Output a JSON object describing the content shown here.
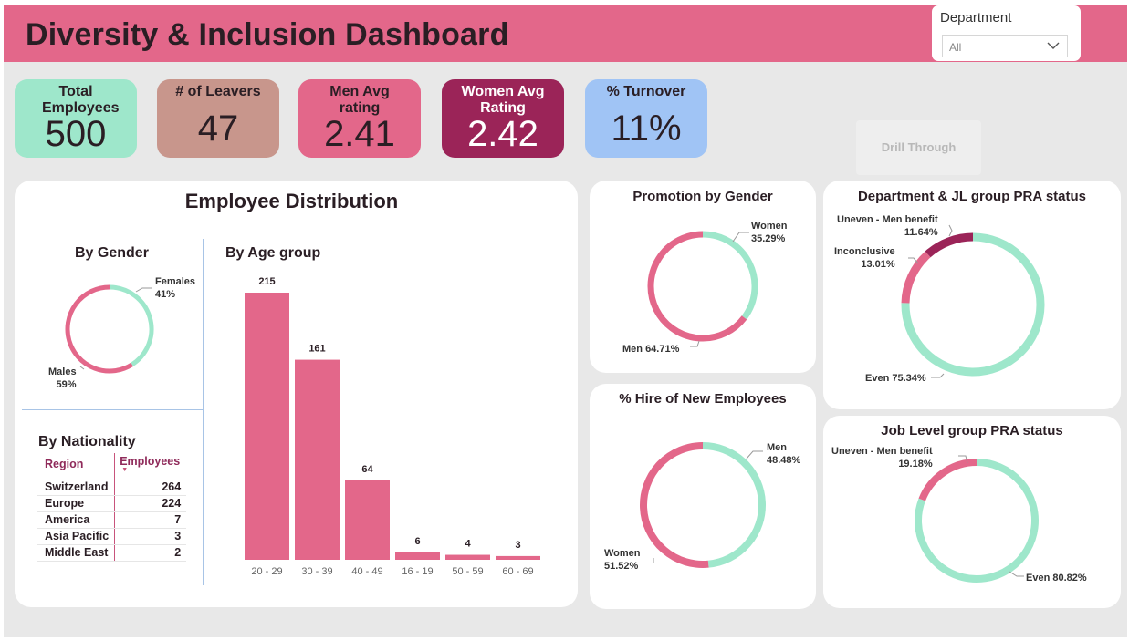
{
  "header": {
    "title": "Diversity & Inclusion Dashboard"
  },
  "slicer": {
    "label": "Department",
    "value": "All",
    "icon": "chevron-down-icon"
  },
  "kpis": [
    {
      "label": "Total Employees",
      "value": "500",
      "color": "#9ee7cb"
    },
    {
      "label": "# of Leavers",
      "value": "47",
      "color": "#c8968c"
    },
    {
      "label": "Men Avg rating",
      "value": "2.41",
      "color": "#e3678a"
    },
    {
      "label": "Women Avg Rating",
      "value": "2.42",
      "color": "#9b2458"
    },
    {
      "label": "% Turnover",
      "value": "11%",
      "color": "#a0c4f5"
    }
  ],
  "drill_through": {
    "label": "Drill Through"
  },
  "employee_distribution": {
    "title": "Employee Distribution",
    "by_gender_title": "By Gender",
    "by_age_title": "By Age group",
    "by_nationality_title": "By Nationality",
    "nationality_table": {
      "columns": [
        "Region",
        "Employees"
      ],
      "rows": [
        [
          "Switzerland",
          "264"
        ],
        [
          "Europe",
          "224"
        ],
        [
          "America",
          "7"
        ],
        [
          "Asia Pacific",
          "3"
        ],
        [
          "Middle East",
          "2"
        ]
      ]
    }
  },
  "colors": {
    "pink": "#e3678a",
    "mint": "#9ee7cb",
    "maroon": "#9b2458"
  },
  "chart_data": [
    {
      "id": "gender",
      "type": "pie",
      "variant": "donut",
      "title": "By Gender",
      "slices": [
        {
          "label": "Females",
          "value": 41,
          "display": "41%",
          "color": "#9ee7cb"
        },
        {
          "label": "Males",
          "value": 59,
          "display": "59%",
          "color": "#e3678a"
        }
      ]
    },
    {
      "id": "age",
      "type": "bar",
      "title": "By Age group",
      "categories": [
        "20 - 29",
        "30 - 39",
        "40 - 49",
        "16 - 19",
        "50 - 59",
        "60 - 69"
      ],
      "values": [
        215,
        161,
        64,
        6,
        4,
        3
      ],
      "color": "#e3678a",
      "ylim": [
        0,
        215
      ]
    },
    {
      "id": "promotion",
      "type": "pie",
      "variant": "donut",
      "title": "Promotion by Gender",
      "slices": [
        {
          "label": "Women",
          "value": 35.29,
          "display": "35.29%",
          "color": "#9ee7cb"
        },
        {
          "label": "Men",
          "value": 64.71,
          "display": "64.71%",
          "color": "#e3678a"
        }
      ]
    },
    {
      "id": "hire",
      "type": "pie",
      "variant": "donut",
      "title": "% Hire of New Employees",
      "slices": [
        {
          "label": "Men",
          "value": 48.48,
          "display": "48.48%",
          "color": "#9ee7cb"
        },
        {
          "label": "Women",
          "value": 51.52,
          "display": "51.52%",
          "color": "#e3678a"
        }
      ]
    },
    {
      "id": "dept_pra",
      "type": "pie",
      "variant": "donut",
      "title": "Department & JL group PRA status",
      "slices": [
        {
          "label": "Even",
          "value": 75.34,
          "display": "75.34%",
          "color": "#9ee7cb"
        },
        {
          "label": "Inconclusive",
          "value": 13.01,
          "display": "13.01%",
          "color": "#e3678a"
        },
        {
          "label": "Uneven - Men benefit",
          "value": 11.64,
          "display": "11.64%",
          "color": "#9b2458"
        }
      ]
    },
    {
      "id": "jl_pra",
      "type": "pie",
      "variant": "donut",
      "title": "Job Level group PRA status",
      "slices": [
        {
          "label": "Even",
          "value": 80.82,
          "display": "80.82%",
          "color": "#9ee7cb"
        },
        {
          "label": "Uneven - Men benefit",
          "value": 19.18,
          "display": "19.18%",
          "color": "#e3678a"
        }
      ]
    }
  ]
}
